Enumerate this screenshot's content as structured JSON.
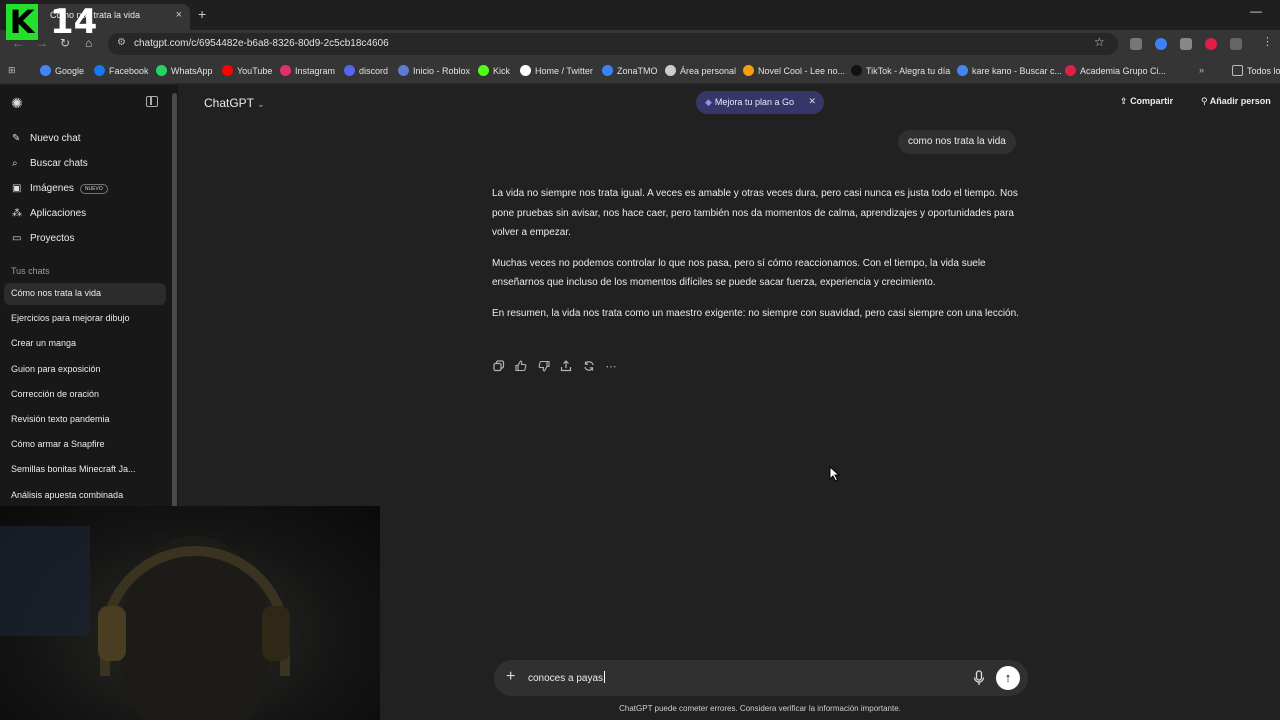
{
  "browser": {
    "tab_title": "Cómo nos trata la vida",
    "tab_close": "×",
    "new_tab": "+",
    "url": "chatgpt.com/c/6954482e-b6a8-8326-80d9-2c5cb18c4606",
    "bookmarks": [
      {
        "label": "Google",
        "color": "#4285f4"
      },
      {
        "label": "Facebook",
        "color": "#1877f2"
      },
      {
        "label": "WhatsApp",
        "color": "#25d366"
      },
      {
        "label": "YouTube",
        "color": "#ff0000"
      },
      {
        "label": "Instagram",
        "color": "#e1306c"
      },
      {
        "label": "discord",
        "color": "#5865f2"
      },
      {
        "label": "Inicio - Roblox",
        "color": "#5b7bd5"
      },
      {
        "label": "Kick",
        "color": "#53fc18"
      },
      {
        "label": "Home / Twitter",
        "color": "#ffffff"
      },
      {
        "label": "ZonaTMO",
        "color": "#3b82f6"
      },
      {
        "label": "Área personal",
        "color": "#cccccc"
      },
      {
        "label": "Novel Cool - Lee no...",
        "color": "#f59e0b"
      },
      {
        "label": "TikTok - Alegra tu día",
        "color": "#111111"
      },
      {
        "label": "kare kano - Buscar c...",
        "color": "#4285f4"
      },
      {
        "label": "Academia Grupo Ci...",
        "color": "#e11d48"
      }
    ],
    "all_bookmarks": "Todos lo"
  },
  "overlay": {
    "logo_letter": "K",
    "logo_number": "14"
  },
  "sidebar": {
    "actions": [
      {
        "label": "Nuevo chat",
        "icon": "edit-icon"
      },
      {
        "label": "Buscar chats",
        "icon": "search-icon"
      },
      {
        "label": "Imágenes",
        "icon": "image-icon",
        "badge": "NUEVO"
      },
      {
        "label": "Aplicaciones",
        "icon": "apps-icon"
      },
      {
        "label": "Proyectos",
        "icon": "folder-icon"
      }
    ],
    "chats_heading": "Tus chats",
    "chats": [
      "Cómo nos trata la vida",
      "Ejercicios para mejorar dibujo",
      "Crear un manga",
      "Guion para exposición",
      "Corrección de oración",
      "Revisión texto pandemia",
      "Cómo armar a Snapfire",
      "Semillas bonitas Minecraft Ja...",
      "Análisis apuesta combinada"
    ]
  },
  "header": {
    "model": "ChatGPT",
    "upgrade": "Mejora tu plan a Go",
    "share": "Compartir",
    "add_people": "Añadir person"
  },
  "conversation": {
    "user_message": "como nos trata la vida",
    "assistant_paragraphs": [
      "La vida no siempre nos trata igual. A veces es amable y otras veces dura, pero casi nunca es justa todo el tiempo. Nos pone pruebas sin avisar, nos hace caer, pero también nos da momentos de calma, aprendizajes y oportunidades para volver a empezar.",
      "Muchas veces no podemos controlar lo que nos pasa, pero sí cómo reaccionamos. Con el tiempo, la vida suele enseñarnos que incluso de los momentos difíciles se puede sacar fuerza, experiencia y crecimiento.",
      "En resumen, la vida nos trata como un maestro exigente: no siempre con suavidad, pero casi siempre con una lección."
    ]
  },
  "composer": {
    "value": "conoces a payas",
    "disclaimer": "ChatGPT puede cometer errores. Considera verificar la información importante."
  }
}
